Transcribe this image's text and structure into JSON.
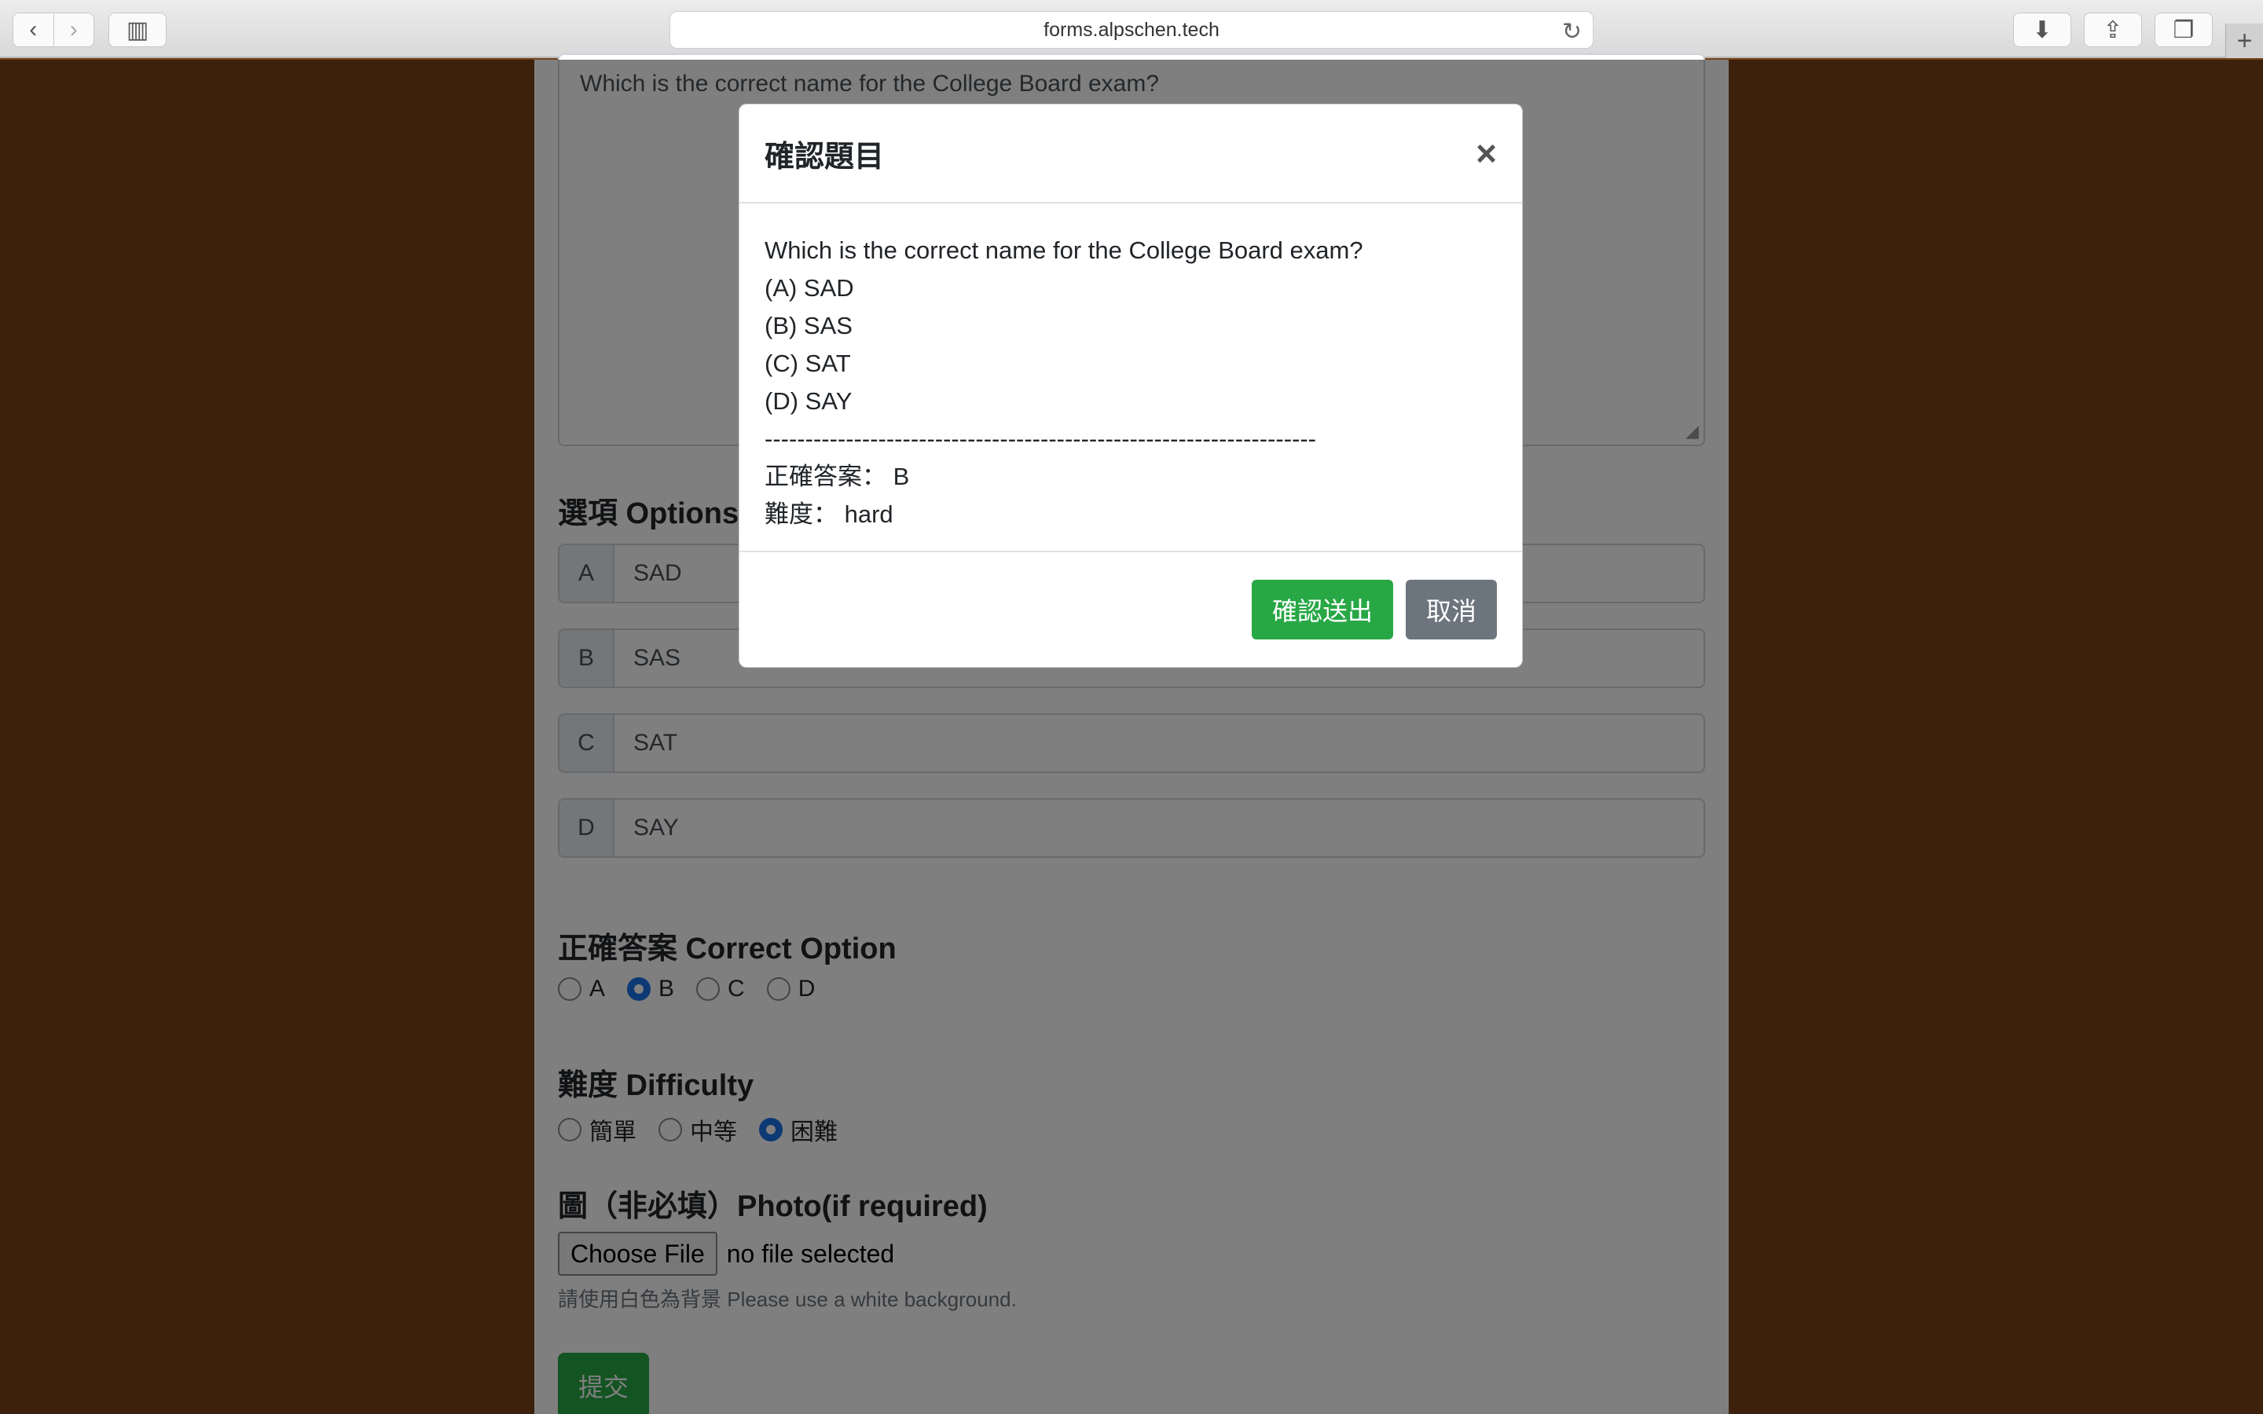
{
  "browser": {
    "url": "forms.alpschen.tech",
    "back_icon": "‹",
    "forward_icon": "›",
    "sidebar_icon": "▥",
    "reload_icon": "↻",
    "download_icon": "⬇",
    "share_icon": "⇪",
    "tabs_icon": "❐",
    "newtab_icon": "+"
  },
  "form": {
    "question_text": "Which is the correct name for the College Board exam?",
    "options_title": "選項 Options",
    "options": [
      {
        "letter": "A",
        "value": "SAD"
      },
      {
        "letter": "B",
        "value": "SAS"
      },
      {
        "letter": "C",
        "value": "SAT"
      },
      {
        "letter": "D",
        "value": "SAY"
      }
    ],
    "correct_title": "正確答案 Correct Option",
    "correct_choices": [
      "A",
      "B",
      "C",
      "D"
    ],
    "correct_selected": "B",
    "difficulty_title": "難度 Difficulty",
    "difficulty_choices": [
      "簡單",
      "中等",
      "困難"
    ],
    "difficulty_selected": "困難",
    "photo_title": "圖（非必填）Photo(if required)",
    "file_button": "Choose File",
    "file_status": "no file selected",
    "photo_help": "請使用白色為背景 Please use a white background.",
    "submit_label": "提交"
  },
  "modal": {
    "title": "確認題目",
    "close_icon": "×",
    "question": "Which is the correct name for the College Board exam?",
    "option_lines": [
      "(A) SAD",
      "(B) SAS",
      "(C) SAT",
      "(D) SAY"
    ],
    "divider": "--------------------------------------------------------------------",
    "answer_line": "正確答案： B",
    "difficulty_line": "難度： hard",
    "confirm_label": "確認送出",
    "cancel_label": "取消"
  },
  "colors": {
    "page_background": "#7a4318",
    "success": "#28a745",
    "secondary": "#6c757d",
    "radio_checked": "#1a73e8"
  }
}
